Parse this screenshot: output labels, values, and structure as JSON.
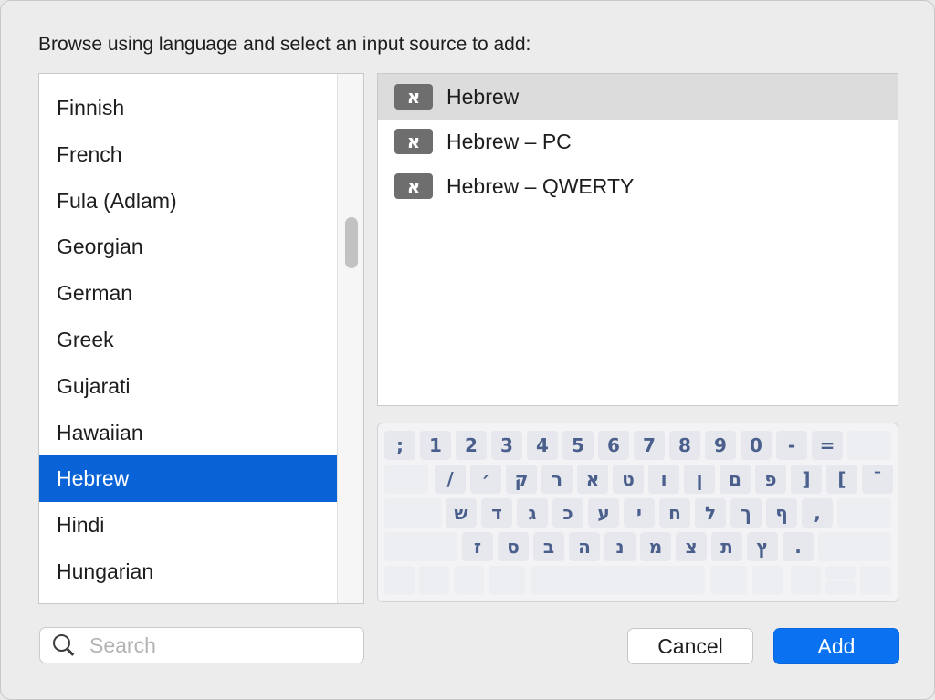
{
  "dialog": {
    "prompt": "Browse using language and select an input source to add:"
  },
  "languages": {
    "items": [
      "Finnish",
      "French",
      "Fula (Adlam)",
      "Georgian",
      "German",
      "Greek",
      "Gujarati",
      "Hawaiian",
      "Hebrew",
      "Hindi",
      "Hungarian"
    ],
    "selected": "Hebrew"
  },
  "sources": {
    "badge_glyph": "א",
    "items": [
      "Hebrew",
      "Hebrew – PC",
      "Hebrew – QWERTY"
    ],
    "selected": "Hebrew"
  },
  "keyboard": {
    "row1": [
      ";",
      "1",
      "2",
      "3",
      "4",
      "5",
      "6",
      "7",
      "8",
      "9",
      "0",
      "-",
      "="
    ],
    "row2": [
      "/",
      "׳",
      "ק",
      "ר",
      "א",
      "ט",
      "ו",
      "ן",
      "ם",
      "פ",
      "]",
      "[",
      "ˉ"
    ],
    "row3": [
      "ש",
      "ד",
      "ג",
      "כ",
      "ע",
      "י",
      "ח",
      "ל",
      "ך",
      "ף",
      ","
    ],
    "row4": [
      "ז",
      "ס",
      "ב",
      "ה",
      "נ",
      "מ",
      "צ",
      "ת",
      "ץ",
      "."
    ]
  },
  "search": {
    "placeholder": "Search",
    "value": ""
  },
  "buttons": {
    "cancel": "Cancel",
    "add": "Add"
  },
  "colors": {
    "selection": "#0a63d6",
    "add_button": "#0a72f0",
    "key_text": "#4a5f8c"
  }
}
